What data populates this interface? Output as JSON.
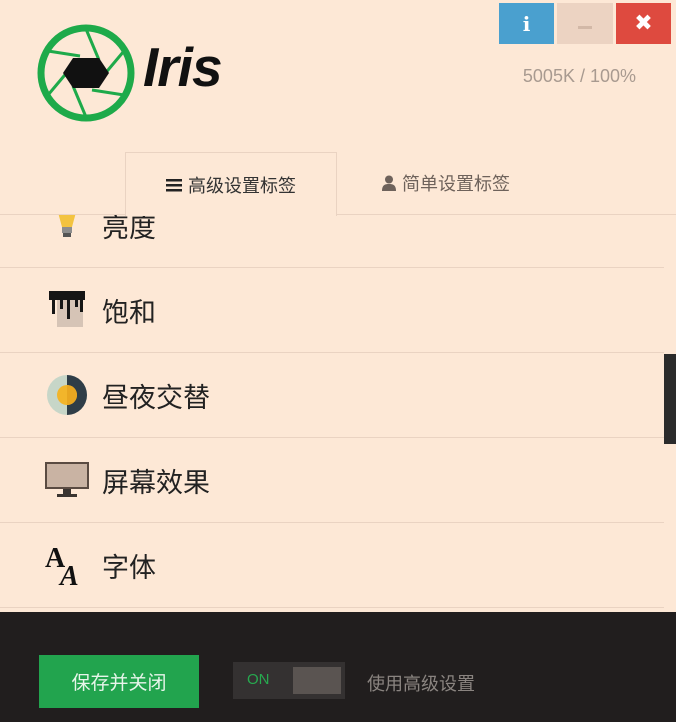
{
  "window": {
    "info_label": "i",
    "close_label": "✖"
  },
  "brand": {
    "name": "Iris",
    "status": "5005K / 100%"
  },
  "tabs": [
    {
      "label": "高级设置标签",
      "icon": "menu-icon",
      "active": true
    },
    {
      "label": "简单设置标签",
      "icon": "user-icon",
      "active": false
    }
  ],
  "settings": {
    "items": [
      {
        "label": "亮度",
        "icon": "bulb-icon"
      },
      {
        "label": "饱和",
        "icon": "paint-icon"
      },
      {
        "label": "昼夜交替",
        "icon": "day-night-icon"
      },
      {
        "label": "屏幕效果",
        "icon": "monitor-icon"
      },
      {
        "label": "字体",
        "icon": "font-icon"
      }
    ]
  },
  "footer": {
    "save_label": "保存并关闭",
    "toggle_state": "ON",
    "toggle_label": "使用高级设置"
  },
  "colors": {
    "background": "#fde8d6",
    "accent_green": "#22a44e",
    "info_blue": "#4aa0cf",
    "close_red": "#de4a3f",
    "footer_dark": "#211e1e"
  }
}
